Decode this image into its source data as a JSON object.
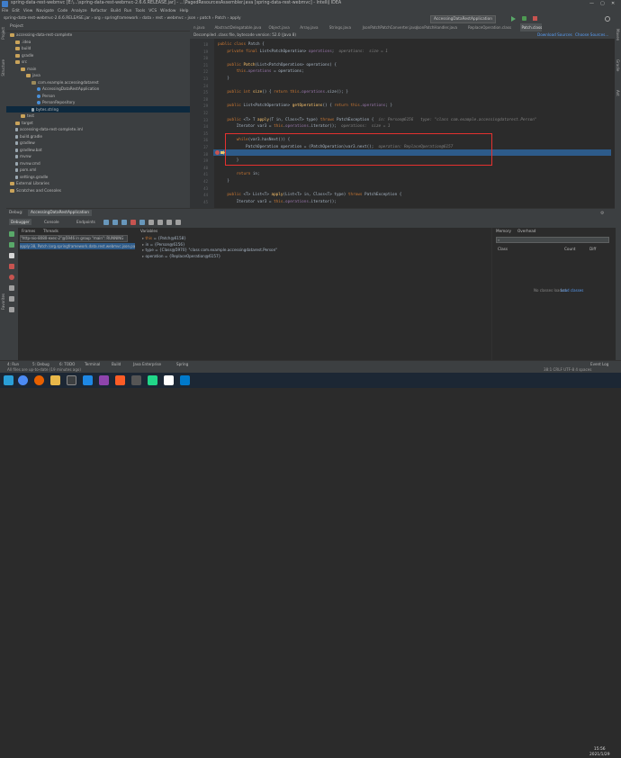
{
  "window": {
    "title": "spring-data-rest-webmvc [E:\\...\\spring-data-rest-webmvc-2.6.6.RELEASE.jar] - ...\\PagedResourcesAssembler.java [spring-data-rest-webmvc] - IntelliJ IDEA",
    "controls": [
      "—",
      "▢",
      "✕"
    ]
  },
  "menu": [
    "File",
    "Edit",
    "View",
    "Navigate",
    "Code",
    "Analyze",
    "Refactor",
    "Build",
    "Run",
    "Tools",
    "VCS",
    "Window",
    "Help"
  ],
  "nav": {
    "breadcrumb": "spring-data-rest-webmvc-2.6.6.RELEASE.jar › org › springframework › data › rest › webmvc › json › patch › Patch › apply",
    "run_config": "AccessingDataRestApplication"
  },
  "left_strip": [
    "Project",
    "Structure",
    "Favorites"
  ],
  "right_strip": [
    "Maven",
    "Gradle",
    "Ant"
  ],
  "project": {
    "header": "Project",
    "items": [
      {
        "label": "accessing-data-rest-complete",
        "indent": 0,
        "icon": "folder-icon"
      },
      {
        "label": ".idea",
        "indent": 1,
        "icon": "folder-icon"
      },
      {
        "label": "build",
        "indent": 1,
        "icon": "folder-icon"
      },
      {
        "label": "gradle",
        "indent": 1,
        "icon": "folder-icon"
      },
      {
        "label": "src",
        "indent": 1,
        "icon": "folder-icon"
      },
      {
        "label": "main",
        "indent": 2,
        "icon": "folder-icon"
      },
      {
        "label": "java",
        "indent": 3,
        "icon": "folder-icon"
      },
      {
        "label": "com.example.accessingdatarest",
        "indent": 4,
        "icon": "package-icon"
      },
      {
        "label": "AccessingDataRestApplication",
        "indent": 5,
        "icon": "class-icon"
      },
      {
        "label": "Person",
        "indent": 5,
        "icon": "class-icon"
      },
      {
        "label": "PersonRepository",
        "indent": 5,
        "icon": "class-icon"
      },
      {
        "label": "bytes.string",
        "indent": 4,
        "icon": "file-icon",
        "selected": true
      },
      {
        "label": "test",
        "indent": 2,
        "icon": "folder-icon"
      },
      {
        "label": "target",
        "indent": 1,
        "icon": "folder-icon"
      },
      {
        "label": "accessing-data-rest-complete.iml",
        "indent": 1,
        "icon": "file-icon"
      },
      {
        "label": "build.gradle",
        "indent": 1,
        "icon": "file-icon"
      },
      {
        "label": "gradlew",
        "indent": 1,
        "icon": "file-icon"
      },
      {
        "label": "gradlew.bat",
        "indent": 1,
        "icon": "file-icon"
      },
      {
        "label": "mvnw",
        "indent": 1,
        "icon": "file-icon"
      },
      {
        "label": "mvnw.cmd",
        "indent": 1,
        "icon": "file-icon"
      },
      {
        "label": "pom.xml",
        "indent": 1,
        "icon": "file-icon"
      },
      {
        "label": "settings.gradle",
        "indent": 1,
        "icon": "file-icon"
      },
      {
        "label": "External Libraries",
        "indent": 0,
        "icon": "library-icon"
      },
      {
        "label": "Scratches and Consoles",
        "indent": 0,
        "icon": "scratch-icon"
      }
    ]
  },
  "editor": {
    "tabs": [
      {
        "label": "n.java",
        "active": false
      },
      {
        "label": "AbstractDelegatable.java",
        "active": false
      },
      {
        "label": "Object.java",
        "active": false
      },
      {
        "label": "Array.java",
        "active": false
      },
      {
        "label": "Strings.java",
        "active": false
      },
      {
        "label": "JsonPatchPatchConverter.java",
        "active": false
      },
      {
        "label": "JsonPatchHandler.java",
        "active": false
      },
      {
        "label": "ReplaceOperation.class",
        "active": false
      },
      {
        "label": "Patch.class",
        "active": true
      }
    ],
    "notice": "Decompiled .class file, bytecode version: 52.0 (Java 8)",
    "notice_actions": [
      "Download Sources",
      "Choose Sources..."
    ],
    "lines": [
      {
        "n": "18",
        "parts": [
          [
            "kw",
            "public class "
          ],
          [
            "ty",
            "Patch {"
          ]
        ]
      },
      {
        "n": "19",
        "parts": [
          [
            "kw",
            "    private final "
          ],
          [
            "ty",
            "List<PatchOperation> "
          ],
          [
            "fd",
            "operations"
          ],
          [
            "ty",
            ";  "
          ],
          [
            "cm",
            "operations:  size = 1"
          ]
        ]
      },
      {
        "n": "20",
        "parts": []
      },
      {
        "n": "21",
        "parts": [
          [
            "kw",
            "    public "
          ],
          [
            "fn",
            "Patch"
          ],
          [
            "ty",
            "(List<PatchOperation> operations) {"
          ]
        ]
      },
      {
        "n": "22",
        "parts": [
          [
            "kw",
            "        this"
          ],
          [
            "ty",
            "."
          ],
          [
            "fd",
            "operations"
          ],
          [
            "ty",
            " = operations;"
          ]
        ]
      },
      {
        "n": "23",
        "parts": [
          [
            "ty",
            "    }"
          ]
        ]
      },
      {
        "n": "24",
        "parts": []
      },
      {
        "n": "25",
        "parts": [
          [
            "kw",
            "    public int "
          ],
          [
            "fn",
            "size"
          ],
          [
            "ty",
            "() { "
          ],
          [
            "kw",
            "return this"
          ],
          [
            "ty",
            "."
          ],
          [
            "fd",
            "operations"
          ],
          [
            "ty",
            ".size(); }"
          ]
        ]
      },
      {
        "n": "28",
        "parts": []
      },
      {
        "n": "29",
        "parts": [
          [
            "kw",
            "    public "
          ],
          [
            "ty",
            "List<PatchOperation> "
          ],
          [
            "fn",
            "getOperations"
          ],
          [
            "ty",
            "() { "
          ],
          [
            "kw",
            "return this"
          ],
          [
            "ty",
            "."
          ],
          [
            "fd",
            "operations"
          ],
          [
            "ty",
            "; }"
          ]
        ]
      },
      {
        "n": "32",
        "parts": []
      },
      {
        "n": "33",
        "parts": [
          [
            "kw",
            "    public "
          ],
          [
            "ty",
            "<T> T "
          ],
          [
            "fn",
            "apply"
          ],
          [
            "ty",
            "(T in, Class<T> type) "
          ],
          [
            "kw",
            "throws "
          ],
          [
            "ty",
            "PatchException {  "
          ],
          [
            "cm",
            "in: Person@6156   type: \"class com.example.accessingdatarest.Person\""
          ]
        ]
      },
      {
        "n": "34",
        "parts": [
          [
            "ty",
            "        Iterator var3 = "
          ],
          [
            "kw",
            "this"
          ],
          [
            "ty",
            "."
          ],
          [
            "fd",
            "operations"
          ],
          [
            "ty",
            ".iterator();  "
          ],
          [
            "cm",
            "operations:  size = 1"
          ]
        ]
      },
      {
        "n": "35",
        "parts": []
      },
      {
        "n": "36",
        "parts": [
          [
            "kw",
            "        while"
          ],
          [
            "ty",
            "(var3.hasNext()) {"
          ]
        ]
      },
      {
        "n": "37",
        "parts": [
          [
            "ty",
            "            PatchOperation operation = (PatchOperation)var3.next();  "
          ],
          [
            "cm",
            "operation: ReplaceOperation@6157"
          ]
        ]
      },
      {
        "n": "38",
        "parts": [
          [
            "ty",
            "            operation.perform(in, type);  "
          ],
          [
            "cm",
            "operation: ReplaceOperation@6157   in: Person@6156   type: \"class com.example.accessingdatarest.Person\""
          ]
        ]
      },
      {
        "n": "39",
        "parts": [
          [
            "ty",
            "        }"
          ]
        ]
      },
      {
        "n": "40",
        "parts": []
      },
      {
        "n": "41",
        "parts": [
          [
            "kw",
            "        return "
          ],
          [
            "ty",
            "in;"
          ]
        ]
      },
      {
        "n": "42",
        "parts": [
          [
            "ty",
            "    }"
          ]
        ]
      },
      {
        "n": "43",
        "parts": []
      },
      {
        "n": "44",
        "parts": [
          [
            "kw",
            "    public "
          ],
          [
            "ty",
            "<T> List<T> "
          ],
          [
            "fn",
            "apply"
          ],
          [
            "ty",
            "(List<T> in, Class<T> type) "
          ],
          [
            "kw",
            "throws "
          ],
          [
            "ty",
            "PatchException {"
          ]
        ]
      },
      {
        "n": "45",
        "parts": [
          [
            "ty",
            "        Iterator var3 = "
          ],
          [
            "kw",
            "this"
          ],
          [
            "ty",
            "."
          ],
          [
            "fd",
            "operations"
          ],
          [
            "ty",
            ".iterator();"
          ]
        ]
      }
    ]
  },
  "debug": {
    "tab_label": "Debug:",
    "config": "AccessingDataRestApplication",
    "subtabs": [
      "Debugger",
      "Console",
      "Endpoints"
    ],
    "frames_header": "Frames",
    "threads_header": "Threads",
    "thread_select": "\"http-nio-8080-exec-2\"@5946 in group \"main\": RUNNING",
    "frames": [
      {
        "label": "apply:38, Patch (org.springframework.data.rest.webmvc.json.patch)",
        "selected": true
      }
    ],
    "variables_header": "Variables",
    "variables": [
      {
        "name": "this",
        "value": "= {Patch@6158}",
        "color": "#cc7832"
      },
      {
        "name": "in",
        "value": "= {Person@6156}",
        "color": "#a9b7c6"
      },
      {
        "name": "type",
        "value": "= {Class@5970} \"class com.example.accessingdatarest.Person\"",
        "color": "#a9b7c6"
      },
      {
        "name": "operation",
        "value": "= {ReplaceOperation@6157}",
        "color": "#a9b7c6"
      }
    ],
    "watch_tabs": [
      "Memory",
      "Overhead"
    ],
    "watch_search_placeholder": "",
    "watch_columns": [
      "Class",
      "Count",
      "Diff"
    ],
    "watch_empty": "No classes loaded.",
    "watch_link": "Load classes"
  },
  "bottom_tabs": [
    "4: Run",
    "5: Debug",
    "6: TODO",
    "Terminal",
    "Build",
    "Java Enterprise",
    "Spring",
    "Event Log"
  ],
  "status_text": "All files are up-to-date (19 minutes ago)",
  "status_right": "38:1  CRLF  UTF-8  4 spaces",
  "clock": {
    "time": "15:56",
    "date": "2021/1/29"
  },
  "colors": {
    "accent": "#2d5b8a",
    "highlight_box": "#e5312f",
    "breakpoint": "#c75450"
  }
}
